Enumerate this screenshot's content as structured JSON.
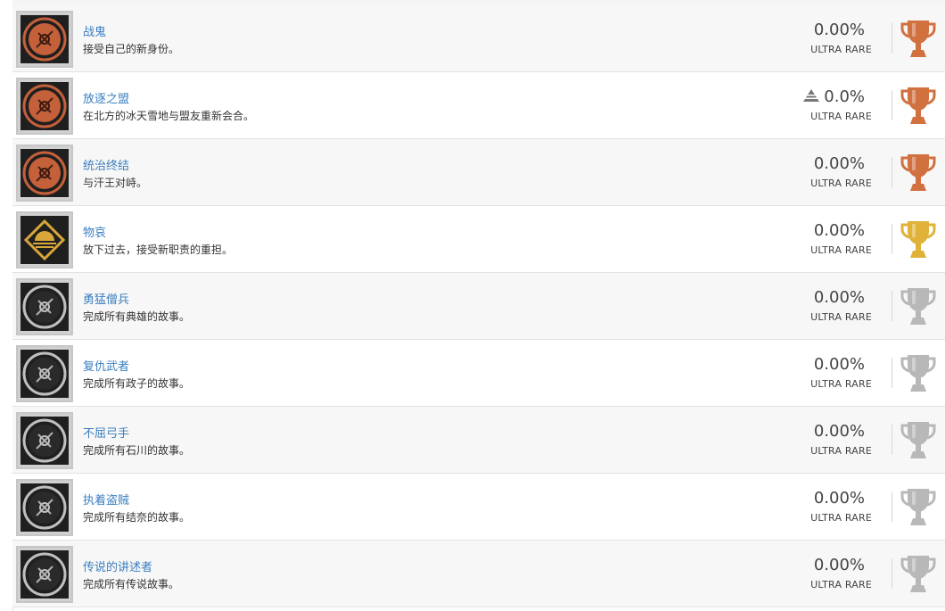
{
  "trophies": [
    {
      "title": "战鬼",
      "description": "接受自己的新身份。",
      "percent": "0.00%",
      "rarity": "ULTRA RARE",
      "grade": "bronze",
      "icon": "demon-face-icon",
      "thumb_color": "#c4603a",
      "rising": false
    },
    {
      "title": "放逐之盟",
      "description": "在北方的冰天雪地与盟友重新会合。",
      "percent": "0.0%",
      "rarity": "ULTRA RARE",
      "grade": "bronze",
      "icon": "oni-mask-icon",
      "thumb_color": "#c4603a",
      "rising": true
    },
    {
      "title": "统治终结",
      "description": "与汗王对峙。",
      "percent": "0.00%",
      "rarity": "ULTRA RARE",
      "grade": "bronze",
      "icon": "sword-crescent-icon",
      "thumb_color": "#c4603a",
      "rising": false
    },
    {
      "title": "物哀",
      "description": "放下过去，接受新职责的重担。",
      "percent": "0.00%",
      "rarity": "ULTRA RARE",
      "grade": "gold",
      "icon": "sunset-diamond-icon",
      "thumb_color": "#d9a63a",
      "rising": false
    },
    {
      "title": "勇猛僧兵",
      "description": "完成所有典雄的故事。",
      "percent": "0.00%",
      "rarity": "ULTRA RARE",
      "grade": "silver",
      "icon": "monk-weapon-icon",
      "thumb_color": "#bfbfbf",
      "rising": false
    },
    {
      "title": "复仇武者",
      "description": "完成所有政子的故事。",
      "percent": "0.00%",
      "rarity": "ULTRA RARE",
      "grade": "silver",
      "icon": "fan-crest-icon",
      "thumb_color": "#bfbfbf",
      "rising": false
    },
    {
      "title": "不屈弓手",
      "description": "完成所有石川的故事。",
      "percent": "0.00%",
      "rarity": "ULTRA RARE",
      "grade": "silver",
      "icon": "bow-arrows-icon",
      "thumb_color": "#bfbfbf",
      "rising": false
    },
    {
      "title": "执着盗贼",
      "description": "完成所有结奈的故事。",
      "percent": "0.00%",
      "rarity": "ULTRA RARE",
      "grade": "silver",
      "icon": "thief-tools-icon",
      "thumb_color": "#bfbfbf",
      "rising": false
    },
    {
      "title": "传说的讲述者",
      "description": "完成所有传说故事。",
      "percent": "0.00%",
      "rarity": "ULTRA RARE",
      "grade": "silver",
      "icon": "biwa-lute-icon",
      "thumb_color": "#bfbfbf",
      "rising": false
    }
  ],
  "colors": {
    "link": "#3a7ebf",
    "bronze": "#d0713f",
    "gold": "#e0b23a",
    "silver": "#b8b8b8"
  }
}
